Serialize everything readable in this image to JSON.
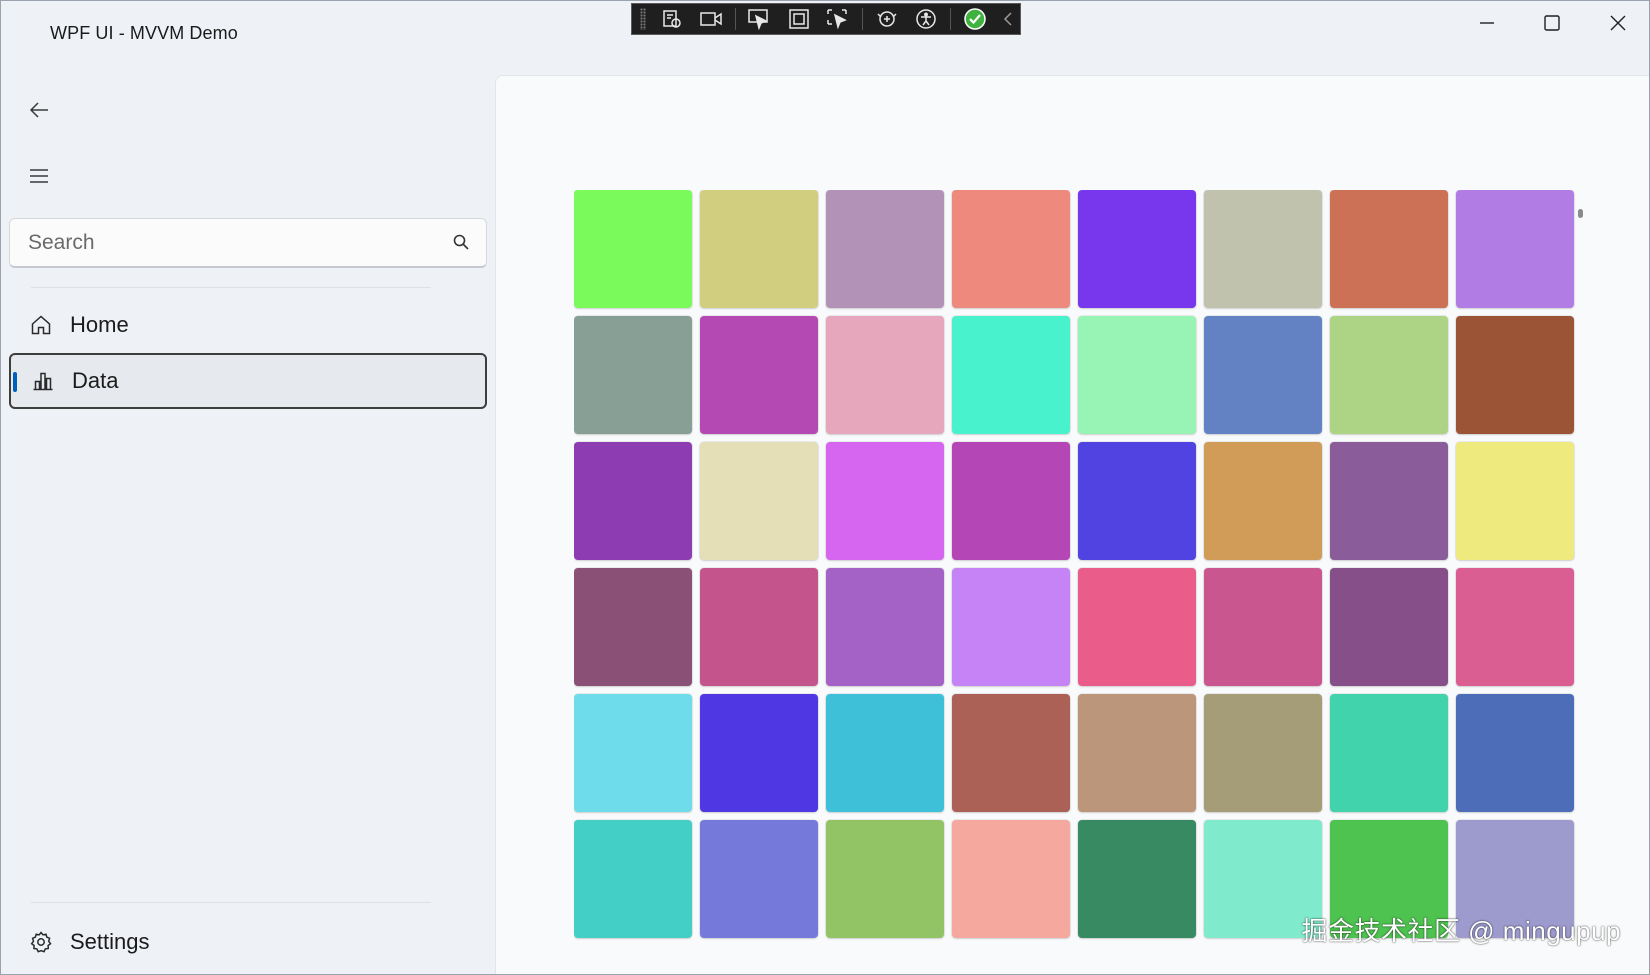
{
  "window": {
    "title": "WPF UI - MVVM Demo"
  },
  "debug_toolbar": {
    "icons": [
      "live-visual-tree-icon",
      "record-icon",
      "select-element-icon",
      "display-layout-adorners-icon",
      "track-focus-icon",
      "hot-reload-icon",
      "accessibility-icon",
      "ui-check-passed-icon",
      "collapse-chevron-icon"
    ]
  },
  "nav": {
    "search_placeholder": "Search",
    "items": [
      {
        "label": "Home",
        "icon": "home-icon",
        "selected": false
      },
      {
        "label": "Data",
        "icon": "data-icon",
        "selected": true
      }
    ],
    "footer": [
      {
        "label": "Settings",
        "icon": "gear-icon"
      }
    ]
  },
  "content": {
    "colors": [
      "#7afa5b",
      "#d2ce80",
      "#b392b8",
      "#ee8a7d",
      "#7837ed",
      "#c1c2ae",
      "#cd7156",
      "#b17de4",
      "#889f95",
      "#b549b4",
      "#e6a6bb",
      "#48f2cc",
      "#98f4b4",
      "#6282c4",
      "#acd484",
      "#9c5436",
      "#8d3cb1",
      "#e4dfb6",
      "#d665f0",
      "#b446b6",
      "#5143e2",
      "#d09c58",
      "#8a5c99",
      "#efea7e",
      "#8a5076",
      "#c4548c",
      "#a461c6",
      "#c683f6",
      "#ea5d8a",
      "#c9568e",
      "#864f8a",
      "#db5e93",
      "#6fdcec",
      "#5037e4",
      "#3ec0d8",
      "#ac6156",
      "#bb967b",
      "#a49d77",
      "#41d3ab",
      "#4e6db8",
      "#44cfc6",
      "#7479da",
      "#92c364",
      "#f5a89d",
      "#378a62",
      "#80eacc",
      "#4ec350",
      "#9d9acd"
    ],
    "watermark": "掘金技术社区 @ mingupup"
  }
}
